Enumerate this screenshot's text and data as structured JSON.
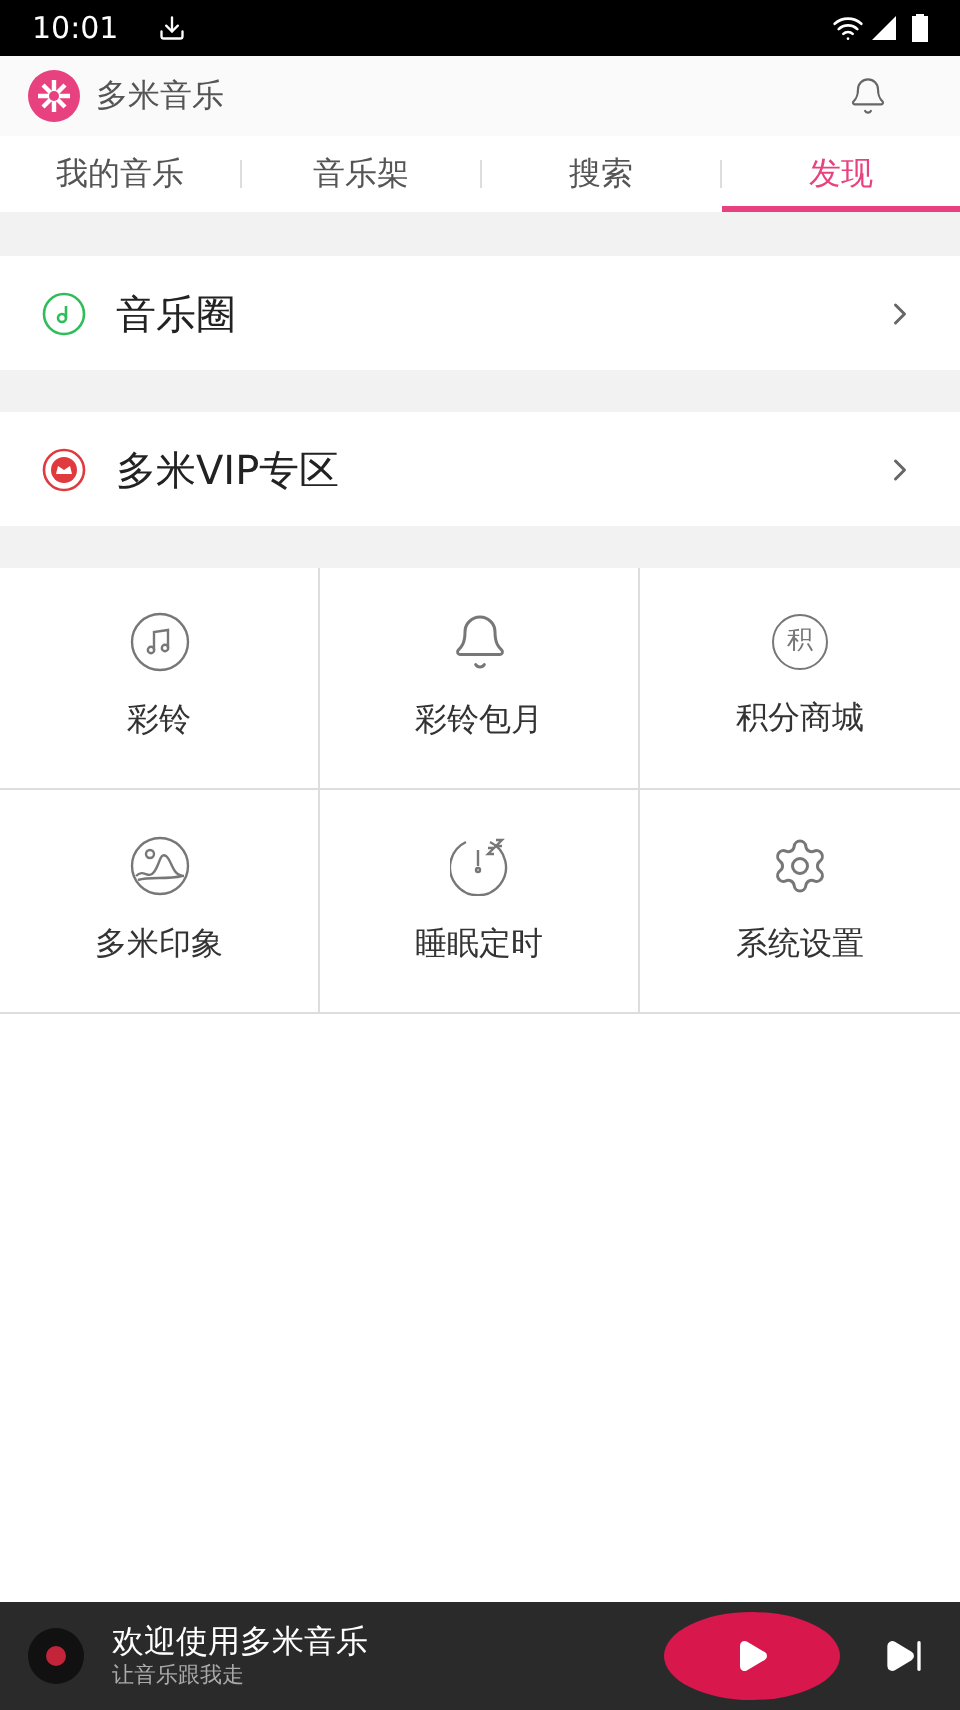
{
  "status_bar": {
    "time": "10:01"
  },
  "header": {
    "title": "多米音乐"
  },
  "tabs": [
    {
      "label": "我的音乐",
      "selected": false
    },
    {
      "label": "音乐架",
      "selected": false
    },
    {
      "label": "搜索",
      "selected": false
    },
    {
      "label": "发现",
      "selected": true
    }
  ],
  "rows": [
    {
      "kind": "circle",
      "label": "音乐圈",
      "color": "#2ebd59"
    },
    {
      "kind": "vip",
      "label": "多米VIP专区",
      "color": "#e0393e"
    }
  ],
  "grid": [
    {
      "kind": "note",
      "label": "彩铃"
    },
    {
      "kind": "bell",
      "label": "彩铃包月"
    },
    {
      "kind": "glyph",
      "glyph": "积",
      "label": "积分商城"
    },
    {
      "kind": "image",
      "label": "多米印象"
    },
    {
      "kind": "sleep",
      "label": "睡眠定时"
    },
    {
      "kind": "gear",
      "label": "系统设置"
    }
  ],
  "player": {
    "title": "欢迎使用多米音乐",
    "subtitle": "让音乐跟我走"
  }
}
